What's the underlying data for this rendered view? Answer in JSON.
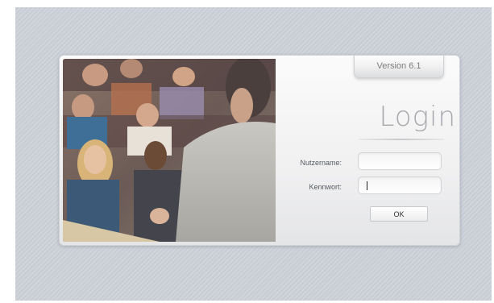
{
  "login_panel": {
    "version_label": "Version 6.1",
    "title": "Login",
    "username_label": "Nutzername:",
    "username_value": "",
    "password_label": "Kennwort:",
    "password_value": "",
    "ok_label": "OK"
  },
  "colors": {
    "background": "#c9ced6",
    "panel": "#f0f0f1",
    "title_text": "#a7a9ad",
    "label_text": "#555a60"
  }
}
